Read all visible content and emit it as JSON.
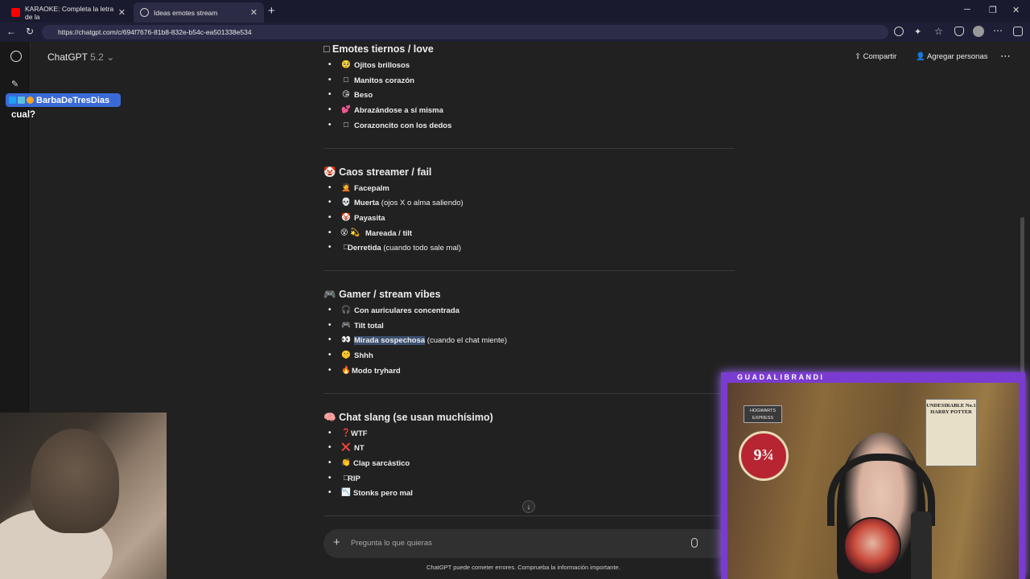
{
  "browser": {
    "tabs": [
      {
        "title": "KARAOKE: Completa la letra de la",
        "active": false
      },
      {
        "title": "Ideas emotes stream",
        "active": true
      }
    ],
    "url": "https://chatgpt.com/c/694f7676-81b8-832e-b54c-ea501338e534"
  },
  "header": {
    "model": "ChatGPT",
    "version": "5.2",
    "share_label": "Compartir",
    "add_people_label": "Agregar personas"
  },
  "sections": [
    {
      "title": "Emotes tiernos / love",
      "icon": "□",
      "items": [
        {
          "icon": "🥺",
          "bold": "Ojitos brillosos",
          "rest": ""
        },
        {
          "icon": "□",
          "bold": "Manitos corazón",
          "rest": ""
        },
        {
          "icon": "😘",
          "bold": "Beso",
          "rest": ""
        },
        {
          "icon": "💕",
          "bold": "Abrazándose a sí misma",
          "rest": ""
        },
        {
          "icon": "□",
          "bold": "Corazoncito con los dedos",
          "rest": ""
        }
      ]
    },
    {
      "title": "Caos streamer / fail",
      "icon": "🤡",
      "items": [
        {
          "icon": "🤦",
          "bold": "Facepalm",
          "rest": ""
        },
        {
          "icon": "💀",
          "bold": "Muerta",
          "rest": " (ojos X o alma saliendo)"
        },
        {
          "icon": "🤡",
          "bold": "Payasita",
          "rest": ""
        },
        {
          "icon": "😵 💫",
          "bold": "Mareada / tilt",
          "rest": ""
        },
        {
          "icon": "□",
          "bold": "Derretida",
          "rest": " (cuando todo sale mal)"
        }
      ]
    },
    {
      "title": "Gamer / stream vibes",
      "icon": "🎮",
      "items": [
        {
          "icon": "🎧",
          "bold": "Con auriculares concentrada",
          "rest": ""
        },
        {
          "icon": "🎮",
          "bold": "Tilt total",
          "rest": ""
        },
        {
          "icon": "👀",
          "bold": "Mirada sospechosa",
          "rest": " (cuando el chat miente)"
        },
        {
          "icon": "🤫",
          "bold": "Shhh",
          "rest": ""
        },
        {
          "icon": "🔥",
          "bold": "Modo tryhard",
          "rest": ""
        }
      ]
    },
    {
      "title": "Chat slang (se usan muchísimo)",
      "icon": "🧠",
      "items": [
        {
          "icon": "❓",
          "bold": "WTF",
          "rest": ""
        },
        {
          "icon": "❌",
          "bold": "NT",
          "rest": ""
        },
        {
          "icon": "👏",
          "bold": "Clap sarcástico",
          "rest": ""
        },
        {
          "icon": "□",
          "bold": "RIP",
          "rest": ""
        },
        {
          "icon": "📉",
          "bold": "Stonks pero mal",
          "rest": ""
        }
      ]
    }
  ],
  "composer": {
    "placeholder": "Pregunta lo que quieras"
  },
  "footer_note": "ChatGPT puede cometer errores. Comprueba la información importante.",
  "stream_overlay": {
    "chat_user": "BarbaDeTresDias",
    "chat_message": "cual?",
    "cam_title": "GUADALIBRANDI",
    "poster_text": "UNDESIRABLE No.1 HARRY POTTER",
    "platform_text": "9¾",
    "sign_text": "HOGWARTS EXPRESS"
  },
  "colors": {
    "bg": "#212121",
    "accent_frame": "#7a3bd1",
    "selection": "#3c4f6e"
  }
}
